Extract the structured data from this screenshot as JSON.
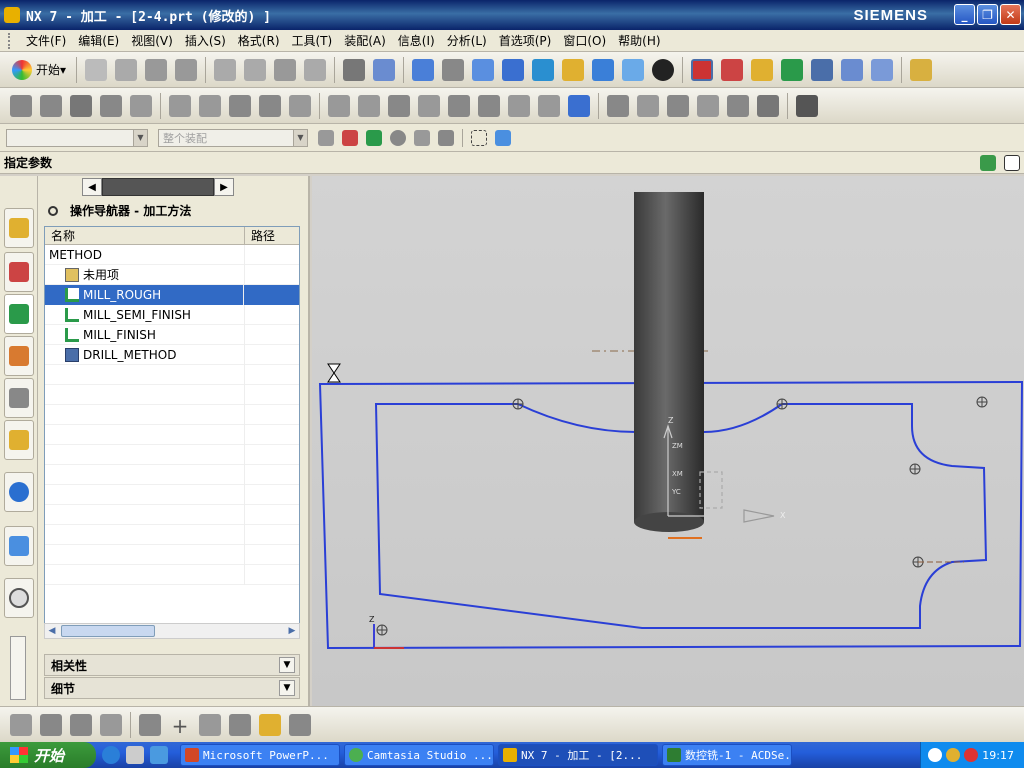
{
  "window": {
    "title": "NX 7 - 加工 - [2-4.prt (修改的) ]",
    "brand": "SIEMENS",
    "min": "_",
    "max": "❐",
    "close": "✕"
  },
  "menu": [
    "文件(F)",
    "编辑(E)",
    "视图(V)",
    "插入(S)",
    "格式(R)",
    "工具(T)",
    "装配(A)",
    "信息(I)",
    "分析(L)",
    "首选项(P)",
    "窗口(O)",
    "帮助(H)"
  ],
  "toolbar": {
    "start_label": "开始"
  },
  "filterbar": {
    "selection_filter": "",
    "assembly_scope": "整个装配"
  },
  "cue": {
    "label": "指定参数"
  },
  "navigator": {
    "title": "操作导航器 - 加工方法",
    "columns": [
      "名称",
      "路径"
    ],
    "rows": [
      {
        "label": "METHOD",
        "icon": "none",
        "indent": 0
      },
      {
        "label": "未用项",
        "icon": "unused-items-icon",
        "indent": 1
      },
      {
        "label": "MILL_ROUGH",
        "icon": "mill-method-icon",
        "indent": 1,
        "selected": true
      },
      {
        "label": "MILL_SEMI_FINISH",
        "icon": "mill-method-icon",
        "indent": 1
      },
      {
        "label": "MILL_FINISH",
        "icon": "mill-method-icon",
        "indent": 1
      },
      {
        "label": "DRILL_METHOD",
        "icon": "drill-method-icon",
        "indent": 1
      }
    ],
    "sections": [
      "相关性",
      "细节"
    ]
  },
  "viewport": {
    "axis_labels": {
      "z": "Z",
      "zm": "ZM",
      "xm": "XM",
      "yc": "YC",
      "x": "X",
      "small_z": "Z"
    }
  },
  "taskbar": {
    "start_label": "开始",
    "tasks": [
      {
        "label": "Microsoft PowerP...",
        "icon_color": "#d24726"
      },
      {
        "label": "Camtasia Studio ...",
        "icon_color": "#4caf50"
      },
      {
        "label": "NX 7 - 加工 - [2...",
        "icon_color": "#e8b000",
        "active": true
      },
      {
        "label": "数控铣-1 - ACDSe...",
        "icon_color": "#2e7d32"
      }
    ],
    "clock": "19:17"
  },
  "colors": {
    "selection": "#316ac5",
    "outline": "#2a3fd6",
    "title_bar": "#0a246a"
  }
}
